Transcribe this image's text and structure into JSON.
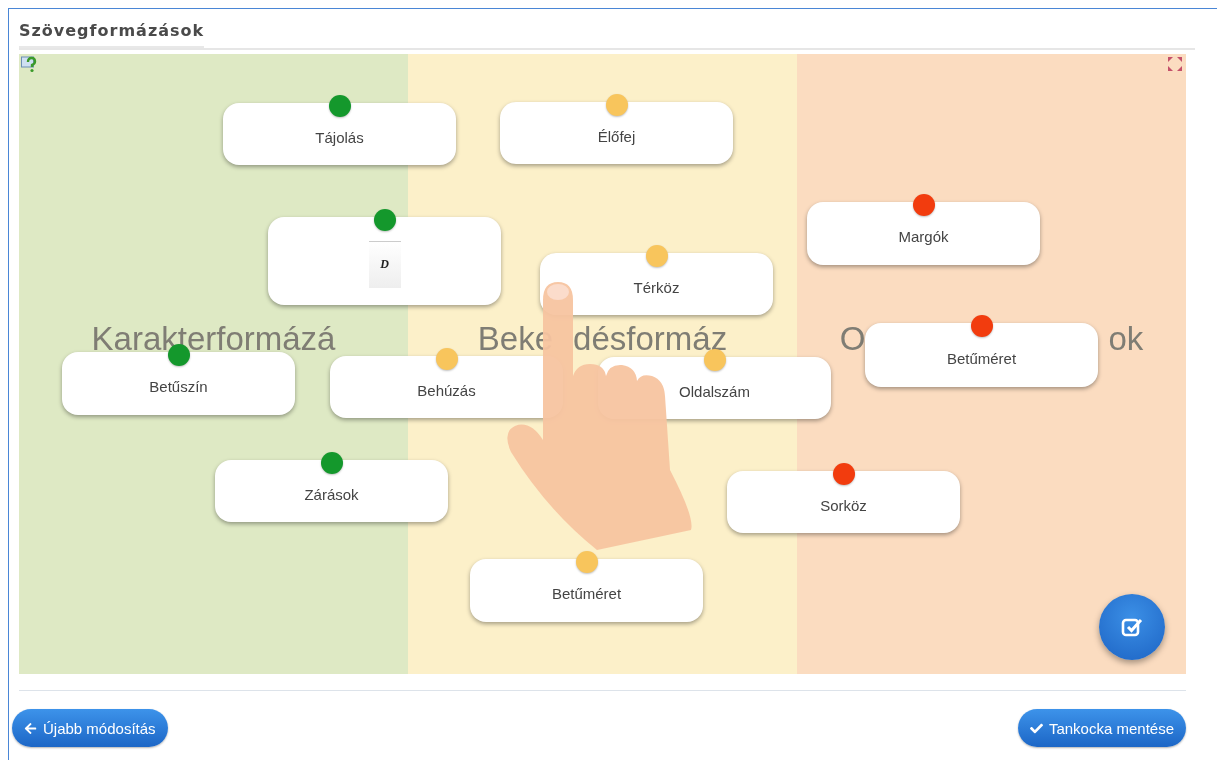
{
  "title": "Szövegformázások",
  "categories": [
    {
      "parts": [
        "Karakterformázá"
      ],
      "color": "#dee9c4"
    },
    {
      "parts": [
        "Beke",
        "désformáz"
      ],
      "color": "#fcf0c9"
    },
    {
      "parts": [
        "O",
        "ok"
      ],
      "color": "#fbdcc0"
    }
  ],
  "cards": [
    {
      "kind": "text",
      "label": "Tájolás",
      "color": "#14982c"
    },
    {
      "kind": "text",
      "label": "Élőfej",
      "color": "#f8c55c"
    },
    {
      "kind": "image",
      "label": "D",
      "color": "#14982c"
    },
    {
      "kind": "text",
      "label": "Margók",
      "color": "#f23c0e"
    },
    {
      "kind": "text",
      "label": "Térköz",
      "color": "#f8c55c"
    },
    {
      "kind": "text",
      "label": "Betűméret",
      "color": "#f23c0e"
    },
    {
      "kind": "text",
      "label": "Betűszín",
      "color": "#14982c"
    },
    {
      "kind": "text",
      "label": "Behúzás",
      "color": "#f8c55c"
    },
    {
      "kind": "text",
      "label": "Oldalszám",
      "color": "#f8c55c"
    },
    {
      "kind": "text",
      "label": "Zárások",
      "color": "#14982c"
    },
    {
      "kind": "text",
      "label": "Sorköz",
      "color": "#f23c0e"
    },
    {
      "kind": "text",
      "label": "Betűméret",
      "color": "#f8c55c"
    }
  ],
  "buttons": {
    "back": "Újabb módosítás",
    "save": "Tankocka mentése"
  }
}
